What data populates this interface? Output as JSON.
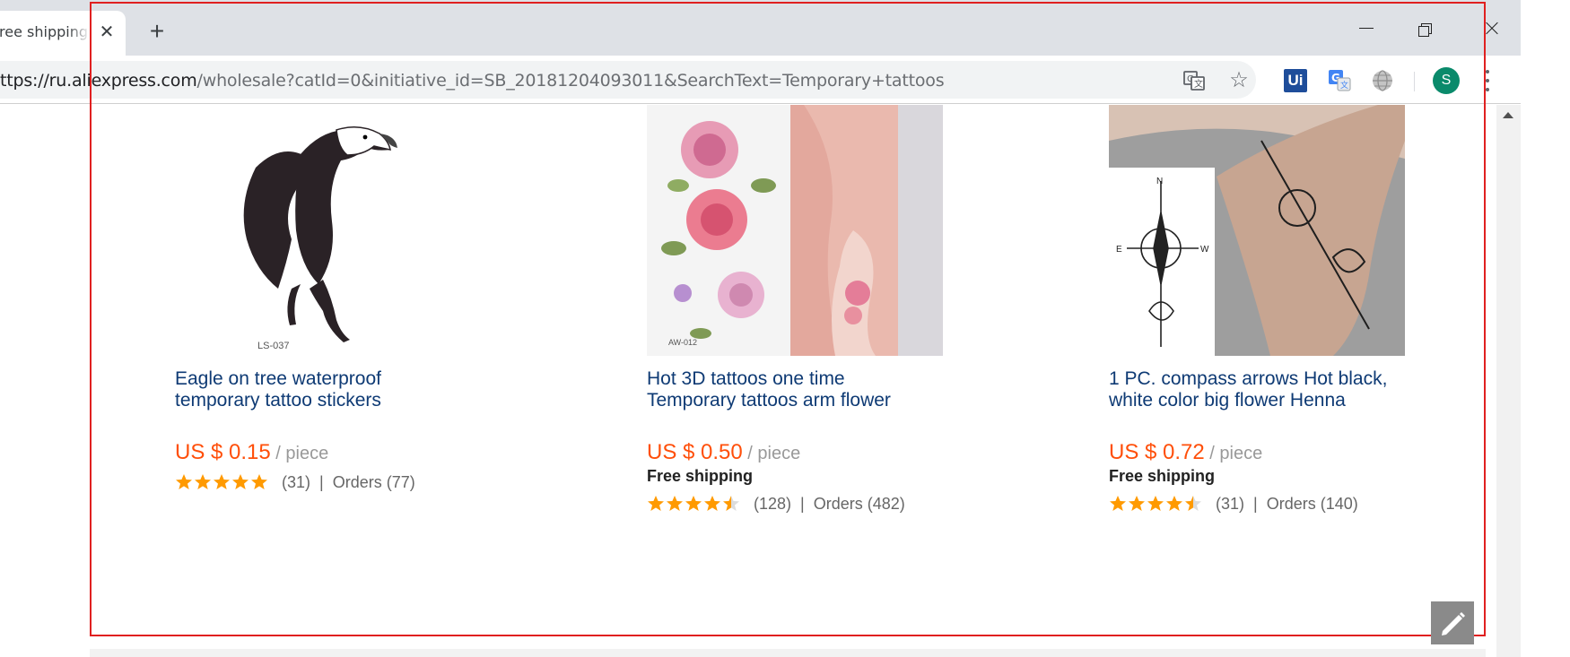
{
  "browser": {
    "tab_title": "ith free shipping",
    "new_tab_symbol": "+",
    "close_symbol": "✕",
    "url_prefix": "ttps://ru.",
    "url_host": "aliexpress.com",
    "url_path": "/wholesale?catId=0&initiative_id=SB_20181204093011&SearchText=Temporary+tattoos",
    "star_symbol": "☆",
    "ext_ui_label": "Ui",
    "avatar_letter": "S"
  },
  "products": [
    {
      "title_line1": "Eagle on tree waterproof",
      "title_line2": "temporary tattoo stickers",
      "price": "US $ 0.15",
      "unit": " / piece",
      "free_shipping": "",
      "rating_count": "(31)",
      "separator": "|",
      "orders": "Orders (77)",
      "stars": 5,
      "image_code": "LS-037"
    },
    {
      "title_line1": "Hot 3D tattoos one time",
      "title_line2": "Temporary tattoos arm flower",
      "price": "US $ 0.50",
      "unit": " / piece",
      "free_shipping": "Free shipping",
      "rating_count": "(128)",
      "separator": "|",
      "orders": "Orders (482)",
      "stars": 4.5,
      "image_code": "AW-012"
    },
    {
      "title_line1": "1 PC. compass arrows Hot black,",
      "title_line2": "white color big flower Henna",
      "price": "US $ 0.72",
      "unit": " / piece",
      "free_shipping": "Free shipping",
      "rating_count": "(31)",
      "separator": "|",
      "orders": "Orders (140)",
      "stars": 4.5,
      "image_code": ""
    }
  ],
  "colors": {
    "price": "#ff4f0a",
    "title_link": "#0e3a74",
    "star": "#ff9a00",
    "highlight_border": "#e02020"
  }
}
